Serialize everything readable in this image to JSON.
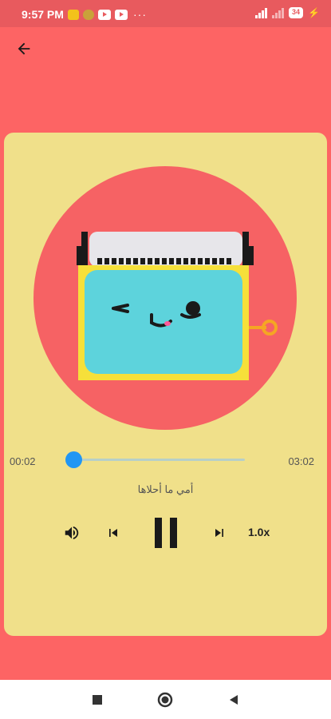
{
  "status_bar": {
    "time": "9:57 PM",
    "battery": "34",
    "overflow": "···"
  },
  "player": {
    "elapsed": "00:02",
    "duration": "03:02",
    "progress": 0.01,
    "title": "أمي ما أحلاها",
    "speed": "1.0x"
  },
  "colors": {
    "background": "#fd6464",
    "card": "#f0e08a",
    "disc": "#f66264",
    "accent": "#2196f3"
  },
  "icons": {
    "back": "arrow-left-icon",
    "volume": "volume-icon",
    "previous": "skip-previous-icon",
    "pause": "pause-icon",
    "next": "skip-next-icon"
  }
}
